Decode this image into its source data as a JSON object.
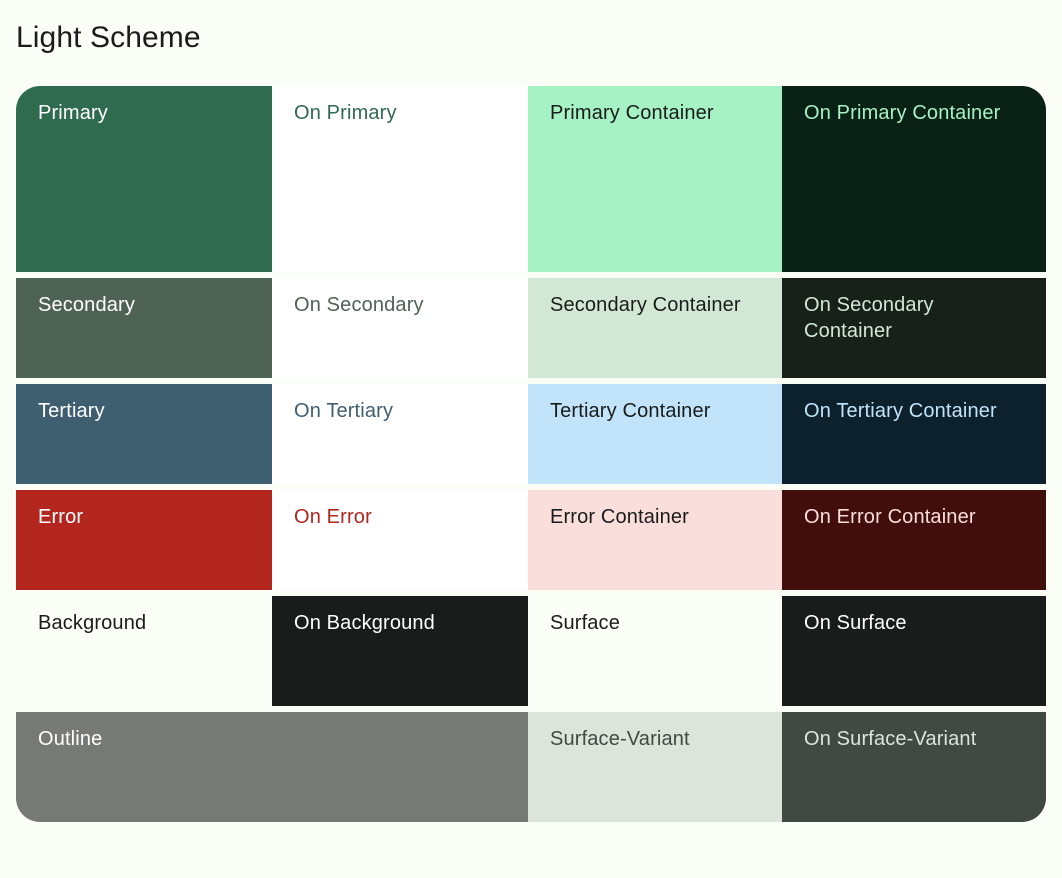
{
  "header": {
    "title": "Light Scheme"
  },
  "palette": {
    "background": "#FBFDF7",
    "on_background": "#191C1A",
    "primary": "#2E6B4F",
    "on_primary": "#FFFFFF",
    "primary_container": "#A6F2C5",
    "on_primary_container": "#0A2116",
    "secondary": "#4F6354",
    "on_secondary": "#FFFFFF",
    "secondary_container": "#D2E8D5",
    "on_secondary_container": "#0D1F14",
    "tertiary": "#3E5F6F",
    "on_tertiary": "#FFFFFF",
    "tertiary_container": "#C1E4FA",
    "on_tertiary_container": "#0A1D26",
    "error": "#B3261E",
    "on_error": "#FFFFFF",
    "error_container": "#F9DEDC",
    "on_error_container": "#410E0B",
    "surface": "#FBFDF7",
    "on_surface": "#191C1A",
    "outline": "#757A75",
    "surface_variant": "#DCE5DC",
    "on_surface_variant": "#404942"
  },
  "rows": [
    {
      "name": "primary-row",
      "size": "tall",
      "cells": [
        {
          "label": "Primary",
          "bg": "#2E6B4F",
          "fg": "#FFFFFF",
          "role": "primary"
        },
        {
          "label": "On Primary",
          "bg": "#FFFFFF",
          "fg": "#2E6B4F",
          "role": "on-primary"
        },
        {
          "label": "Primary Container",
          "bg": "#A6F2C5",
          "fg": "#191C1A",
          "role": "primary-container"
        },
        {
          "label": "On Primary Container",
          "bg": "#0A2116",
          "fg": "#A6F2C5",
          "role": "on-primary-container"
        }
      ]
    },
    {
      "name": "secondary-row",
      "size": "mid",
      "cells": [
        {
          "label": "Secondary",
          "bg": "#4F6354",
          "fg": "#FFFFFF",
          "role": "secondary"
        },
        {
          "label": "On Secondary",
          "bg": "#FFFFFF",
          "fg": "#4F6354",
          "role": "on-secondary"
        },
        {
          "label": "Secondary Container",
          "bg": "#D2E8D5",
          "fg": "#191C1A",
          "role": "secondary-container"
        },
        {
          "label": "On Secondary Container",
          "bg": "#18201A",
          "fg": "#D2E8D5",
          "role": "on-secondary-container"
        }
      ]
    },
    {
      "name": "tertiary-row",
      "size": "mid",
      "cells": [
        {
          "label": "Tertiary",
          "bg": "#3E5F6F",
          "fg": "#FFFFFF",
          "role": "tertiary"
        },
        {
          "label": "On Tertiary",
          "bg": "#FFFFFF",
          "fg": "#3E5F6F",
          "role": "on-tertiary"
        },
        {
          "label": "Tertiary Container",
          "bg": "#C1E4FA",
          "fg": "#191C1A",
          "role": "tertiary-container"
        },
        {
          "label": "On Tertiary Container",
          "bg": "#0C212B",
          "fg": "#C1E4FA",
          "role": "on-tertiary-container"
        }
      ]
    },
    {
      "name": "error-row",
      "size": "mid",
      "cells": [
        {
          "label": "Error",
          "bg": "#B3261E",
          "fg": "#FFFFFF",
          "role": "error"
        },
        {
          "label": "On Error",
          "bg": "#FFFFFF",
          "fg": "#B3261E",
          "role": "on-error"
        },
        {
          "label": "Error Container",
          "bg": "#F9DEDC",
          "fg": "#191C1A",
          "role": "error-container"
        },
        {
          "label": "On Error Container",
          "bg": "#410E0B",
          "fg": "#F9DEDC",
          "role": "on-error-container"
        }
      ]
    },
    {
      "name": "background-surface-row",
      "size": "short",
      "cells": [
        {
          "label": "Background",
          "bg": "#FBFDF7",
          "fg": "#191C1A",
          "role": "background"
        },
        {
          "label": "On Background",
          "bg": "#191C1A",
          "fg": "#FFFFFF",
          "role": "on-background"
        },
        {
          "label": "Surface",
          "bg": "#FBFDF7",
          "fg": "#191C1A",
          "role": "surface"
        },
        {
          "label": "On Surface",
          "bg": "#191C1A",
          "fg": "#FFFFFF",
          "role": "on-surface"
        }
      ]
    },
    {
      "name": "outline-surface-variant-row",
      "size": "short",
      "cells": [
        {
          "label": "Outline",
          "bg": "#757A75",
          "fg": "#FFFFFF",
          "role": "outline"
        },
        {
          "label": "",
          "bg": "#757A75",
          "fg": "#FFFFFF",
          "role": "outline-continued"
        },
        {
          "label": "Surface-Variant",
          "bg": "#DCE5DC",
          "fg": "#404942",
          "role": "surface-variant"
        },
        {
          "label": "On Surface-Variant",
          "bg": "#404942",
          "fg": "#DCE5DC",
          "role": "on-surface-variant"
        }
      ]
    }
  ]
}
